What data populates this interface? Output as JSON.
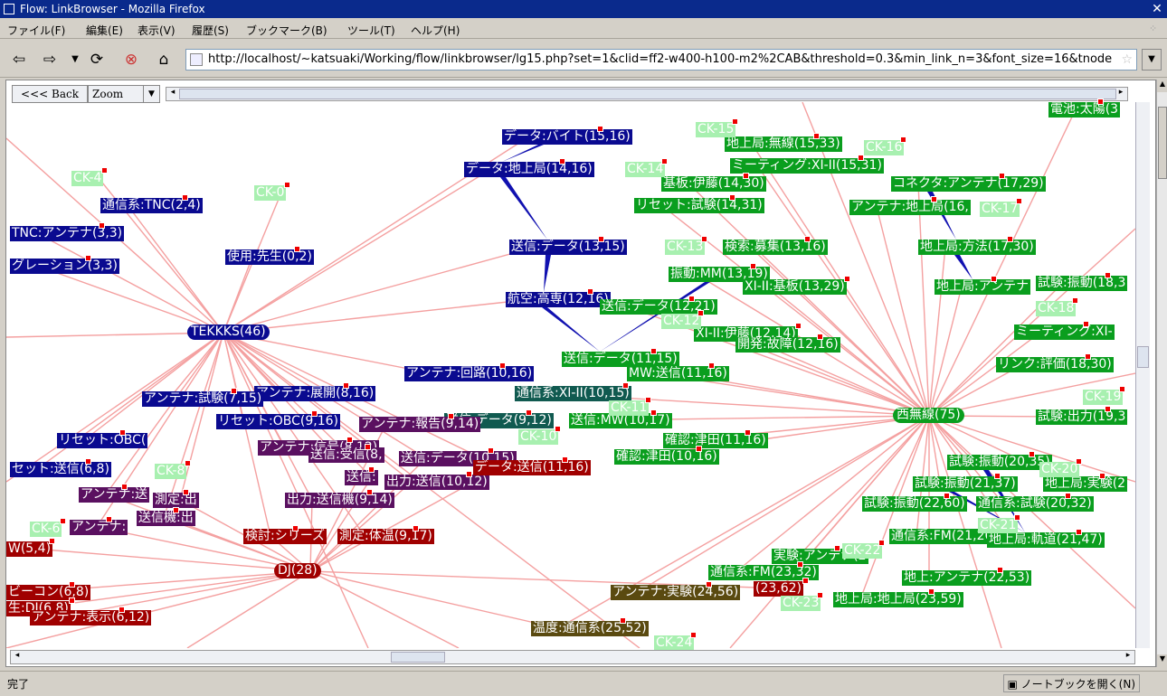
{
  "window": {
    "title": "Flow: LinkBrowser - Mozilla Firefox",
    "close_label": "✕"
  },
  "menu": [
    "ファイル(F)",
    "編集(E)",
    "表示(V)",
    "履歴(S)",
    "ブックマーク(B)",
    "ツール(T)",
    "ヘルプ(H)"
  ],
  "nav": {
    "back_icon": "back-arrow-icon",
    "forward_icon": "forward-arrow-icon",
    "url": "http://localhost/~katsuaki/Working/flow/linkbrowser/lg15.php?set=1&clid=ff2-w400-h100-m2%2CAB&threshold=0.3&min_link_n=3&font_size=16&tnode="
  },
  "applet": {
    "back_label": "<<< Back",
    "zoom_label": "Zoom"
  },
  "graph": {
    "hubs": [
      {
        "label": "TEKKKS(46)",
        "color": "#0a0a90"
      },
      {
        "label": "西無線(75)",
        "color": "#0a9e1e"
      },
      {
        "label": "DJ(28)",
        "color": "#a00000"
      }
    ],
    "nodes": [
      {
        "label": "データ:バイト(15,16)",
        "cls": "nav"
      },
      {
        "label": "データ:地上局(14,16)",
        "cls": "nav"
      },
      {
        "label": "送信:データ(13,15)",
        "cls": "nav"
      },
      {
        "label": "航空:高専(12,16)",
        "cls": "nav"
      },
      {
        "label": "通信系:TNC(2,4)",
        "cls": "nav"
      },
      {
        "label": "TNC:アンテナ(3,3)",
        "cls": "nav"
      },
      {
        "label": "グレーション(3,3)",
        "cls": "nav"
      },
      {
        "label": "使用:先生(0,2)",
        "cls": "nav"
      },
      {
        "label": "アンテナ:回路(10,16)",
        "cls": "nav"
      },
      {
        "label": "アンテナ:展開(8,16)",
        "cls": "nav"
      },
      {
        "label": "アンテナ:試験(7,15)",
        "cls": "nav"
      },
      {
        "label": "リセット:OBC(9,16)",
        "cls": "nav"
      },
      {
        "label": "リセット:OBC(",
        "cls": "nav"
      },
      {
        "label": "セット:送信(6,8)",
        "cls": "nav"
      },
      {
        "label": "CK-4",
        "cls": "nlg"
      },
      {
        "label": "CK-0",
        "cls": "nlg"
      },
      {
        "label": "地上局:無線(15,33)",
        "cls": "ngr"
      },
      {
        "label": "ミーティング:XI-II(15,31)",
        "cls": "ngr"
      },
      {
        "label": "基板:伊藤(14,30)",
        "cls": "ngr"
      },
      {
        "label": "コネクタ:アンテナ(17,29)",
        "cls": "ngr"
      },
      {
        "label": "リセット:試験(14,31)",
        "cls": "ngr"
      },
      {
        "label": "アンテナ:地上局(16,",
        "cls": "ngr"
      },
      {
        "label": "検索:募集(13,16)",
        "cls": "ngr"
      },
      {
        "label": "地上局:方法(17,30)",
        "cls": "ngr"
      },
      {
        "label": "振動:MM(13,19)",
        "cls": "ngr"
      },
      {
        "label": "XI-II:基板(13,29)",
        "cls": "ngr"
      },
      {
        "label": "地上局:アンテナ",
        "cls": "ngr"
      },
      {
        "label": "試験:振動(18,3",
        "cls": "ngr"
      },
      {
        "label": "送信:データ(12,21)",
        "cls": "ngr"
      },
      {
        "label": "XI-II:伊藤(12,14)",
        "cls": "ngr"
      },
      {
        "label": "開発:故障(12,16)",
        "cls": "ngr"
      },
      {
        "label": "ミーティング:XI-",
        "cls": "ngr"
      },
      {
        "label": "送信:データ(11,15)",
        "cls": "ngr"
      },
      {
        "label": "MW:送信(11,16)",
        "cls": "ngr"
      },
      {
        "label": "リンク:評価(18,30)",
        "cls": "ngr"
      },
      {
        "label": "通信系:XI-II(10,15)",
        "cls": "nteal"
      },
      {
        "label": "送信:データ(9,12)",
        "cls": "nteal"
      },
      {
        "label": "送信:MW(10,17)",
        "cls": "ngr"
      },
      {
        "label": "確認:津田(11,16)",
        "cls": "ngr"
      },
      {
        "label": "確認:津田(10,16)",
        "cls": "ngr"
      },
      {
        "label": "試験:出力(19,3",
        "cls": "ngr"
      },
      {
        "label": "試験:振動(20,35)",
        "cls": "ngr"
      },
      {
        "label": "地上局:実験(2",
        "cls": "ngr"
      },
      {
        "label": "試験:振動(21,37)",
        "cls": "ngr"
      },
      {
        "label": "試験:振動(22,60)",
        "cls": "ngr"
      },
      {
        "label": "通信系:試験(20,32)",
        "cls": "ngr"
      },
      {
        "label": "通信系:FM(21,26)",
        "cls": "ngr"
      },
      {
        "label": "地上局:軌道(21,47)",
        "cls": "ngr"
      },
      {
        "label": "実験:アンテナ(2",
        "cls": "ngr"
      },
      {
        "label": "通信系:FM(23,32)",
        "cls": "ngr"
      },
      {
        "label": "地上:アンテナ(22,53)",
        "cls": "ngr"
      },
      {
        "label": "地上局:地上局(23,59)",
        "cls": "ngr"
      },
      {
        "label": "電池:太陽(3",
        "cls": "ngr"
      },
      {
        "label": "アンテナ:報告(9,14)",
        "cls": "npu"
      },
      {
        "label": "アンテナ:信号(8,12)",
        "cls": "npu"
      },
      {
        "label": "送信:受信(8,",
        "cls": "npu"
      },
      {
        "label": "送信:データ(10,15)",
        "cls": "npu"
      },
      {
        "label": "送信:",
        "cls": "npu"
      },
      {
        "label": "出力:送信(10,12)",
        "cls": "npu"
      },
      {
        "label": "アンテナ:送",
        "cls": "npu"
      },
      {
        "label": "測定:出",
        "cls": "npu"
      },
      {
        "label": "出力:送信機(9,14)",
        "cls": "npu"
      },
      {
        "label": "送信機:出",
        "cls": "npu"
      },
      {
        "label": "アンテナ:",
        "cls": "npu"
      },
      {
        "label": "データ:送信(11,16)",
        "cls": "nre"
      },
      {
        "label": "検討:シリーズ",
        "cls": "nre"
      },
      {
        "label": "測定:体温(9,17)",
        "cls": "nre"
      },
      {
        "label": "W(5,4)",
        "cls": "nre"
      },
      {
        "label": "ビーコン(6,8)",
        "cls": "nre"
      },
      {
        "label": "生:DJ(6,8)",
        "cls": "nre"
      },
      {
        "label": "アンテナ:表示(6,12)",
        "cls": "nre"
      },
      {
        "label": "アンテナ:実験(24,56)",
        "cls": "nol"
      },
      {
        "label": "温度:通信系(25,52)",
        "cls": "nol"
      },
      {
        "label": "(23,62)",
        "cls": "nre"
      },
      {
        "label": "CK-13",
        "cls": "nlg"
      },
      {
        "label": "CK-14",
        "cls": "nlg"
      },
      {
        "label": "CK-16",
        "cls": "nlg"
      },
      {
        "label": "CK-12",
        "cls": "nlg"
      },
      {
        "label": "CK-17",
        "cls": "nlg"
      },
      {
        "label": "CK-18",
        "cls": "nlg"
      },
      {
        "label": "CK-19",
        "cls": "nlg"
      },
      {
        "label": "CK-20",
        "cls": "nlg"
      },
      {
        "label": "CK-21",
        "cls": "nlg"
      },
      {
        "label": "CK-22",
        "cls": "nlg"
      },
      {
        "label": "CK-23",
        "cls": "nlg"
      },
      {
        "label": "CK-24",
        "cls": "nlg"
      },
      {
        "label": "CK-6",
        "cls": "nlg"
      },
      {
        "label": "CK-8",
        "cls": "nlg"
      },
      {
        "label": "CK-10",
        "cls": "nlg"
      },
      {
        "label": "CK-11",
        "cls": "nlg"
      },
      {
        "label": "CK-15",
        "cls": "nlg"
      }
    ]
  },
  "status": {
    "text": "完了",
    "notebook": "ノートブックを開く(N)"
  }
}
